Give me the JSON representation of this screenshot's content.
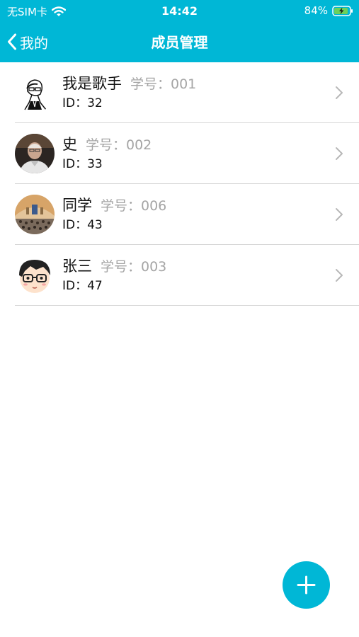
{
  "status_bar": {
    "carrier": "无SIM卡",
    "time": "14:42",
    "battery": "84%"
  },
  "nav": {
    "back_label": "我的",
    "title": "成员管理"
  },
  "members": [
    {
      "name": "我是歌手",
      "student_no": "学号：001",
      "id": "ID：32"
    },
    {
      "name": "史",
      "student_no": "学号：002",
      "id": "ID：33"
    },
    {
      "name": "同学",
      "student_no": "学号：006",
      "id": "ID：43"
    },
    {
      "name": "张三",
      "student_no": "学号：003",
      "id": "ID：47"
    }
  ],
  "icons": {
    "back": "chevron-left-icon",
    "row_arrow": "chevron-right-icon",
    "fab": "plus-icon",
    "wifi": "wifi-icon",
    "battery": "battery-charging-icon"
  },
  "colors": {
    "accent": "#00b7d6",
    "secondary_text": "#a5a5a5",
    "divider": "#d6d6d6"
  }
}
